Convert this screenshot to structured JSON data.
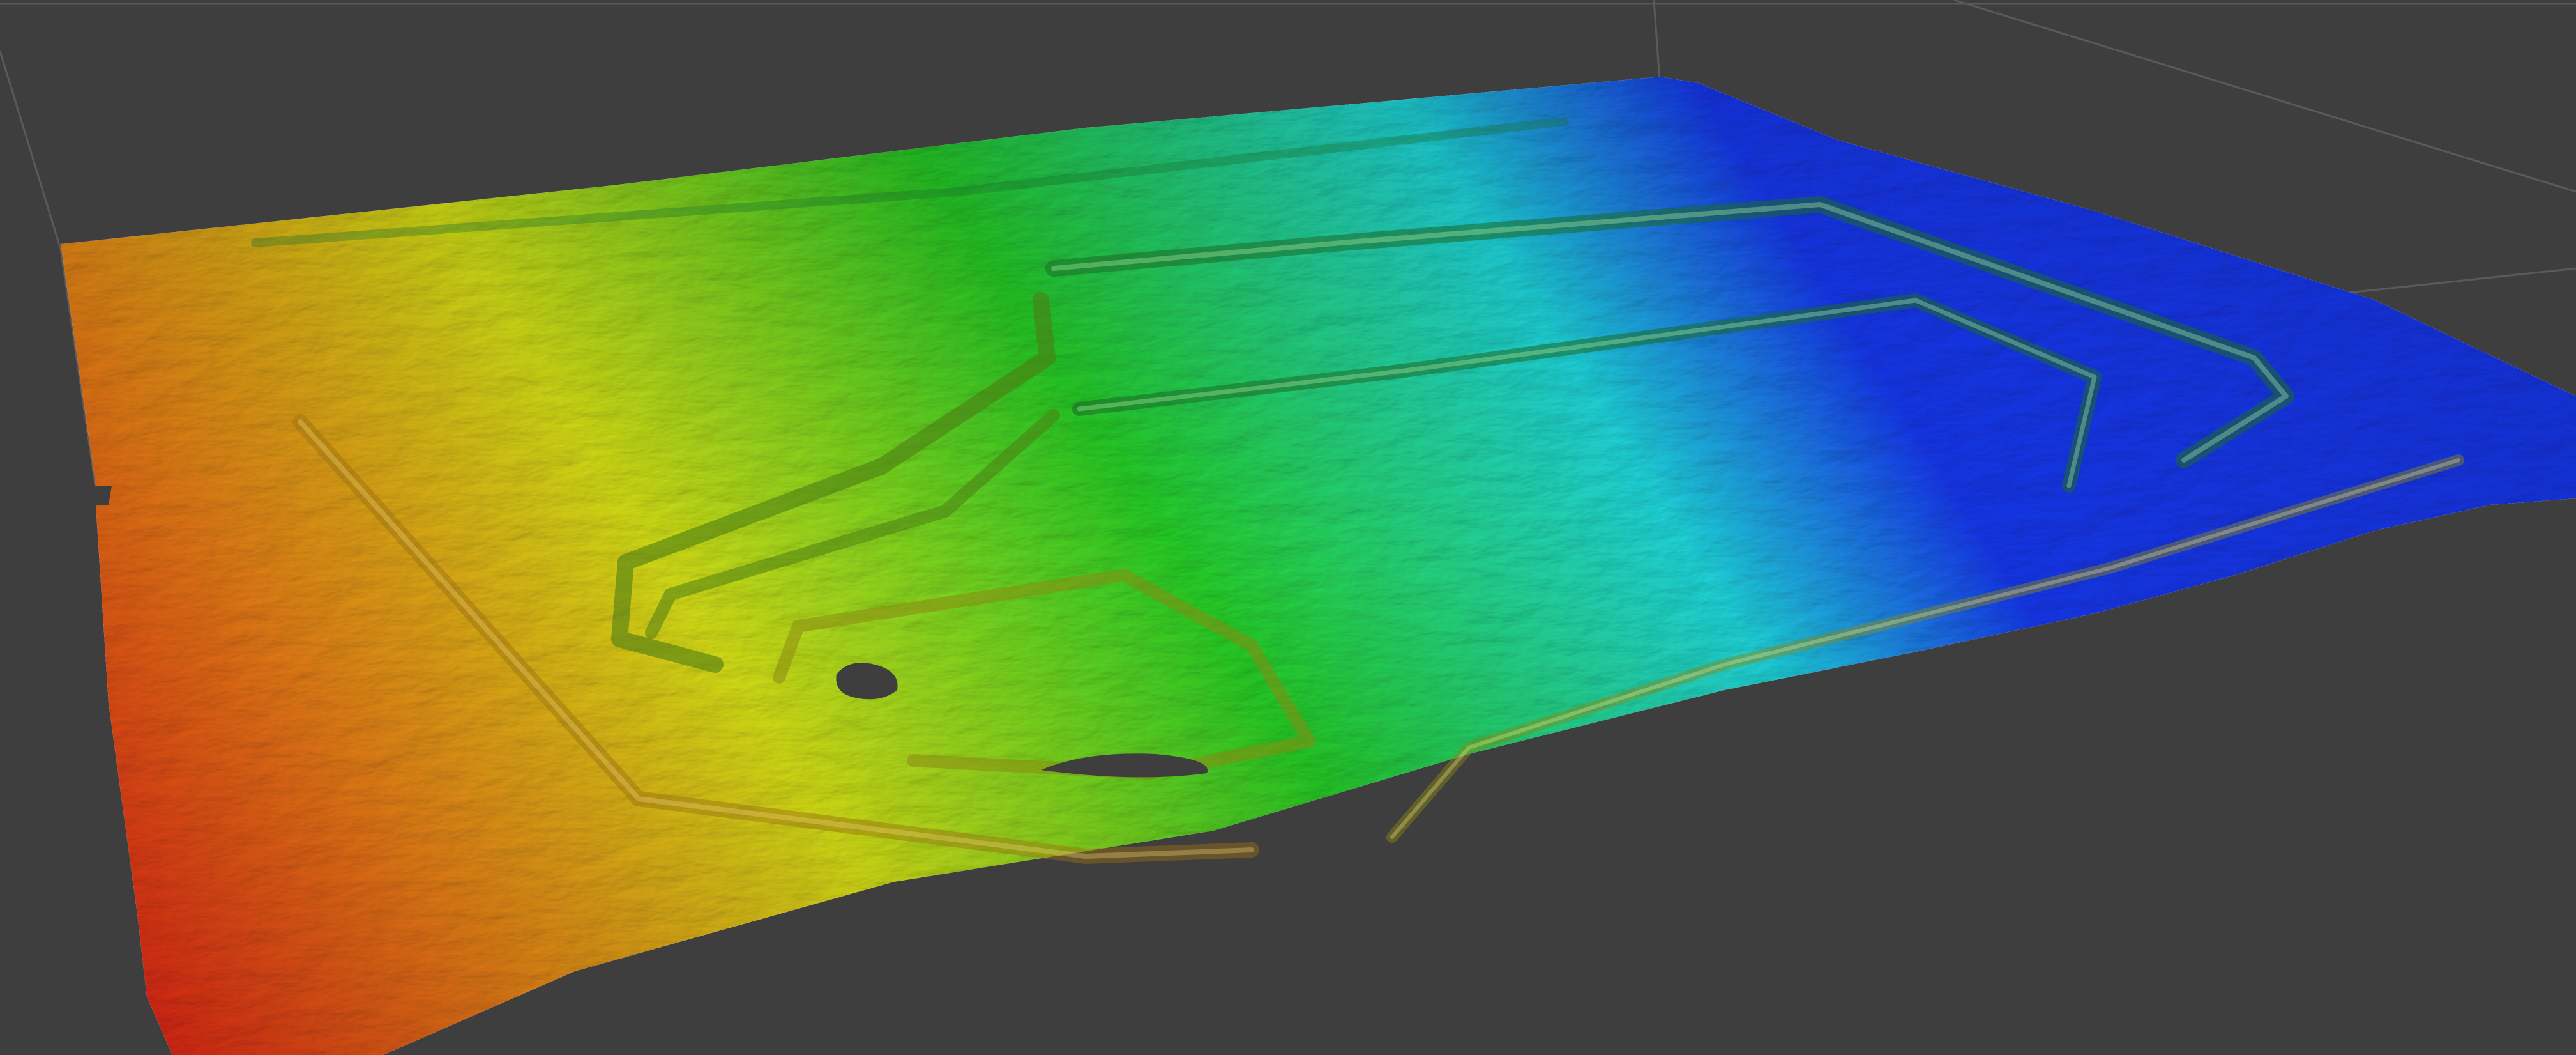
{
  "viewport": {
    "background_color": "#3e3e3e",
    "grid_color": "#5a5a5a"
  },
  "colormap": {
    "low": "#ff2a1a",
    "low_mid": "#ff8c1a",
    "mid": "#e6f01a",
    "mid_high": "#28d428",
    "high": "#22e0e6",
    "top": "#1a3cff"
  },
  "icons": {
    "terrain": "terrain-mesh-icon",
    "grid": "grid-lines-icon"
  }
}
